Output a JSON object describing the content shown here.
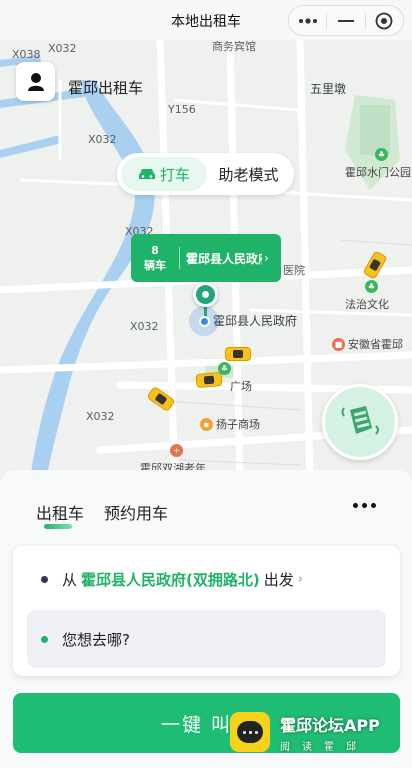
{
  "titlebar": {
    "title": "本地出租车"
  },
  "brand": {
    "name": "霍邱出租车"
  },
  "map": {
    "road_labels": [
      "X038",
      "X032",
      "Y156",
      "X032",
      "X032",
      "X032",
      "X032"
    ],
    "place_labels": [
      "商务宾馆",
      "五里墩",
      "霍邱水门公园",
      "医院",
      "法治文化",
      "霍邱县人民政府",
      "安徽省霍邱",
      "广场",
      "扬子商场",
      "霍邱双湖老年"
    ]
  },
  "mode_toggle": {
    "taxi": "打车",
    "elder": "助老模式"
  },
  "car_bubble": {
    "count": "8",
    "unit": "辆车",
    "place": "霍邱县人民政府"
  },
  "tabs": {
    "taxi": "出租车",
    "reserve": "预约用车"
  },
  "from": {
    "prefix": "从",
    "place": "霍邱县人民政府(双拥路北)",
    "suffix": "出发"
  },
  "destination": {
    "placeholder": "您想去哪?"
  },
  "cta": {
    "label": "一键 叫"
  },
  "watermark": {
    "title": "霍邱论坛APP",
    "subtitle": "阅读霍邱"
  },
  "colors": {
    "accent": "#1fb36a",
    "taxi": "#f8c21a"
  }
}
